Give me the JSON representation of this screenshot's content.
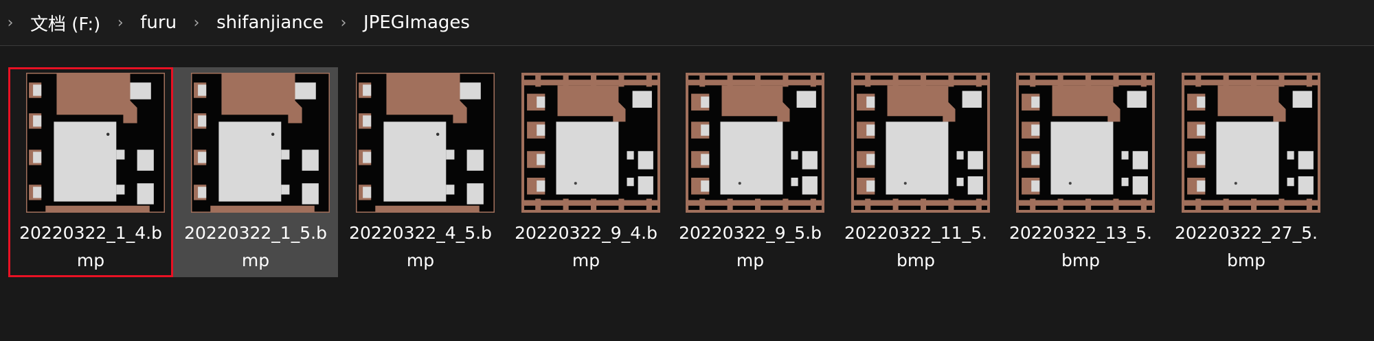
{
  "breadcrumb": {
    "chevron": "›",
    "items": [
      "文档 (F:)",
      "furu",
      "shifanjiance",
      "JPEGImages"
    ]
  },
  "files": [
    {
      "line1": "20220322_1_4.b",
      "line2": "mp",
      "variant": "a",
      "selected": false,
      "outlined": true
    },
    {
      "line1": "20220322_1_5.b",
      "line2": "mp",
      "variant": "a",
      "selected": true,
      "outlined": false
    },
    {
      "line1": "20220322_4_5.b",
      "line2": "mp",
      "variant": "a",
      "selected": false,
      "outlined": false
    },
    {
      "line1": "20220322_9_4.b",
      "line2": "mp",
      "variant": "b",
      "selected": false,
      "outlined": false
    },
    {
      "line1": "20220322_9_5.b",
      "line2": "mp",
      "variant": "b",
      "selected": false,
      "outlined": false
    },
    {
      "line1": "20220322_11_5.",
      "line2": "bmp",
      "variant": "b",
      "selected": false,
      "outlined": false
    },
    {
      "line1": "20220322_13_5.",
      "line2": "bmp",
      "variant": "b",
      "selected": false,
      "outlined": false
    },
    {
      "line1": "20220322_27_5.",
      "line2": "bmp",
      "variant": "b",
      "selected": false,
      "outlined": false
    }
  ],
  "colors": {
    "background": "#191919",
    "copper": "#a1705c",
    "pad": "#d9d9d9",
    "board": "#050505",
    "selection": "#4a4a4a",
    "highlight_box": "#e81123"
  }
}
